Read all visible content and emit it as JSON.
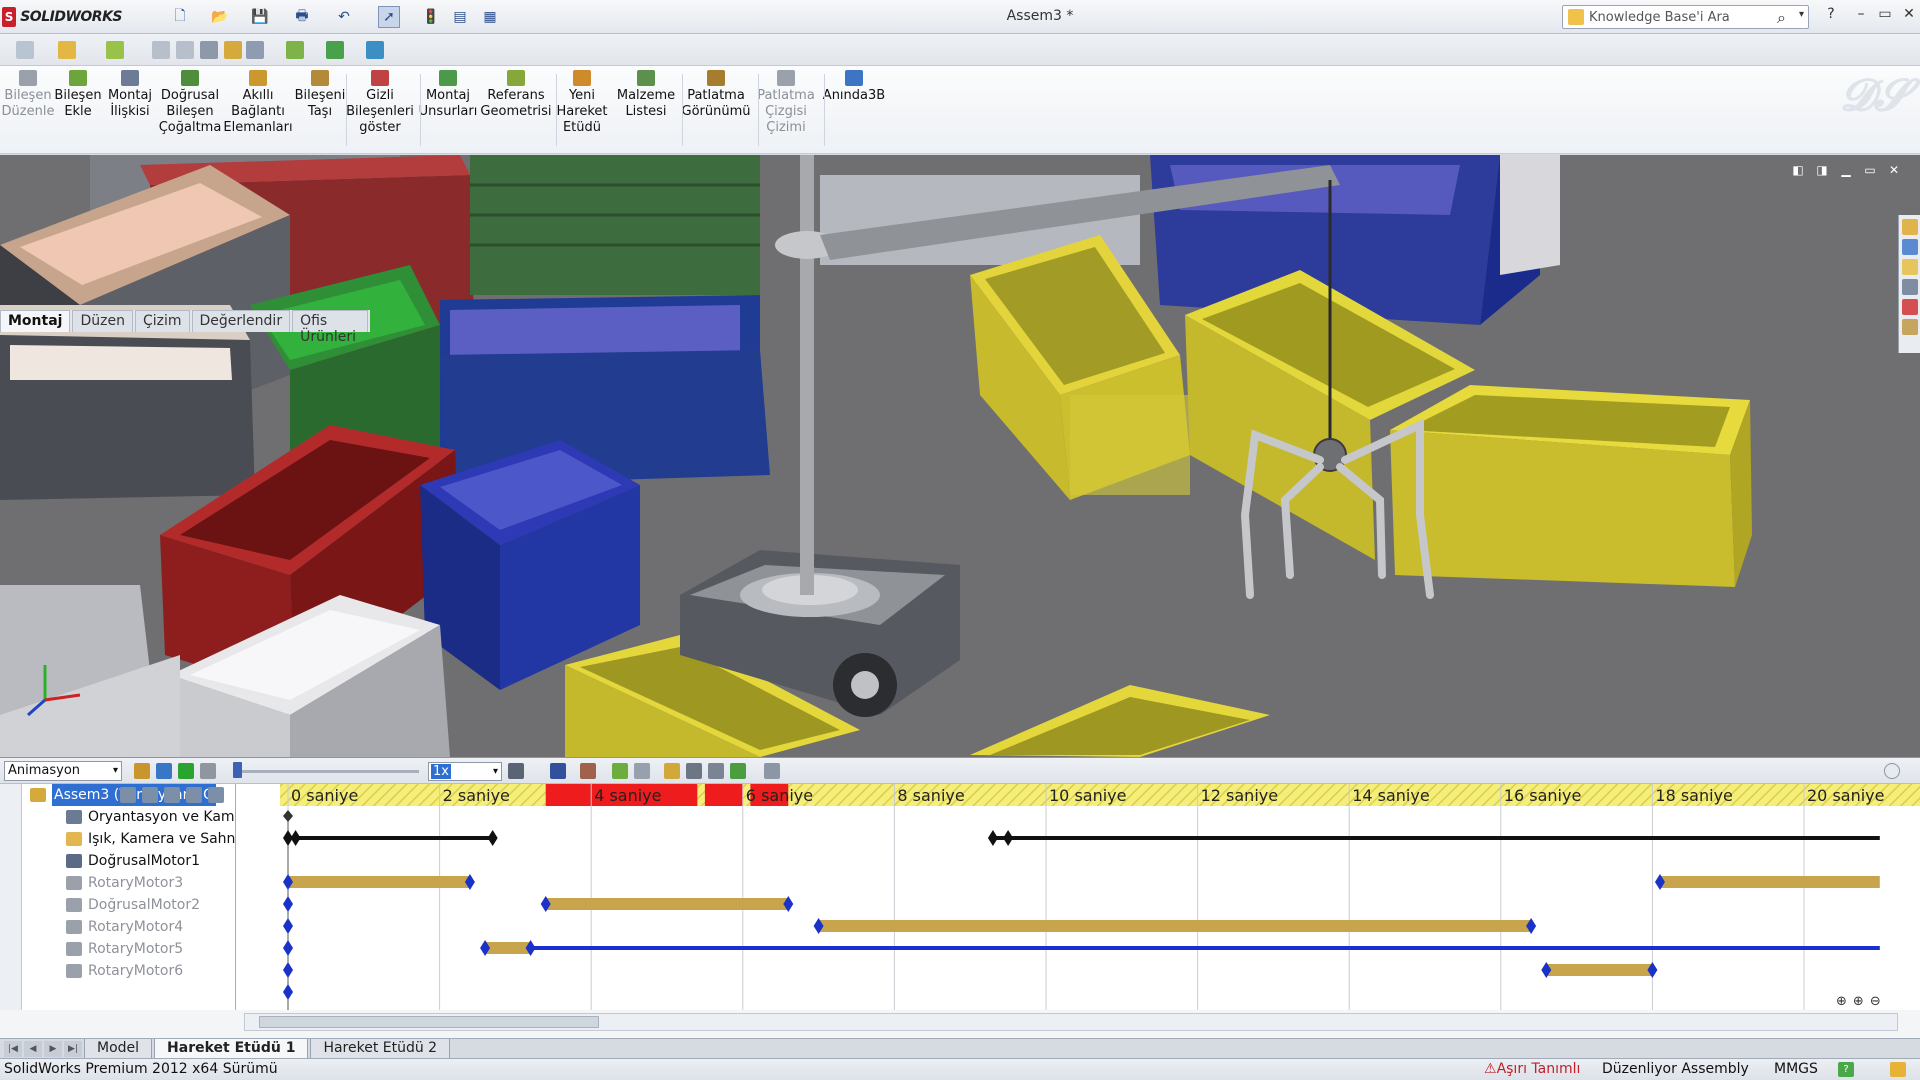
{
  "app": {
    "brand": "SOLIDWORKS",
    "doc_title": "Assem3 *"
  },
  "search": {
    "placeholder": "Knowledge Base'i Ara"
  },
  "window": {
    "help": "?",
    "minimize": "–",
    "restore": "▭",
    "close": "✕"
  },
  "commands": [
    {
      "id": "bileşen-düzenle",
      "label": "Bileşen\nDüzenle",
      "disabled": true,
      "color": "#9aa1ab"
    },
    {
      "id": "bileşen-ekle",
      "label": "Bileşen\nEkle",
      "disabled": false,
      "color": "#6da53c"
    },
    {
      "id": "montaj-ilişkisi",
      "label": "Montaj\nİlişkisi",
      "disabled": false,
      "color": "#6b7c94"
    },
    {
      "id": "doğrusal-çoğaltma",
      "label": "Doğrusal\nBileşen\nÇoğaltma",
      "disabled": false,
      "color": "#4e8e3a"
    },
    {
      "id": "akıllı-bağlantı",
      "label": "Akıllı\nBağlantı\nElemanları",
      "disabled": false,
      "color": "#c9982e"
    },
    {
      "id": "bileşeni-taşı",
      "label": "Bileşeni\nTaşı",
      "disabled": false,
      "color": "#b38a3a"
    },
    {
      "id": "gizli-bileşenler",
      "label": "Gizli\nBileşenleri\ngöster",
      "disabled": false,
      "color": "#c04343"
    },
    {
      "id": "montaj-unsurları",
      "label": "Montaj\nUnsurları",
      "disabled": false,
      "color": "#4c9a49"
    },
    {
      "id": "referans-geometri",
      "label": "Referans\nGeometrisi",
      "disabled": false,
      "color": "#86a83a"
    },
    {
      "id": "yeni-hareket-etüdü",
      "label": "Yeni\nHareket\nEtüdü",
      "disabled": false,
      "color": "#cf8a2b"
    },
    {
      "id": "malzeme-listesi",
      "label": "Malzeme\nListesi",
      "disabled": false,
      "color": "#5d8f4d"
    },
    {
      "id": "patlatma-görünümü",
      "label": "Patlatma\nGörünümü",
      "disabled": false,
      "color": "#a67c2e"
    },
    {
      "id": "patlatma-çizgisi",
      "label": "Patlatma\nÇizgisi\nÇizimi",
      "disabled": true,
      "color": "#9aa1ab"
    },
    {
      "id": "anında-3b",
      "label": "Anında3B",
      "disabled": false,
      "color": "#3e74c4"
    }
  ],
  "tabs": [
    "Montaj",
    "Düzen",
    "Çizim",
    "Değerlendir",
    "Ofis Ürünleri"
  ],
  "motion": {
    "study_type": "Animasyon",
    "speed": "1x",
    "tree": [
      {
        "label": "Assem3  (Varsayılan<G",
        "dim": false,
        "selected": true
      },
      {
        "label": "Oryantasyon ve Kamer",
        "dim": false
      },
      {
        "label": "Işık, Kamera ve Sahne",
        "dim": false
      },
      {
        "label": "DoğrusalMotor1",
        "dim": false
      },
      {
        "label": "RotaryMotor3",
        "dim": true
      },
      {
        "label": "DoğrusalMotor2",
        "dim": true
      },
      {
        "label": "RotaryMotor4",
        "dim": true
      },
      {
        "label": "RotaryMotor5",
        "dim": true
      },
      {
        "label": "RotaryMotor6",
        "dim": true
      }
    ],
    "ruler": [
      "0 saniye",
      "2 saniye",
      "4 saniye",
      "6 saniye",
      "8 saniye",
      "10 saniye",
      "12 saniye",
      "14 saniye",
      "16 saniye",
      "18 saniye",
      "20 saniye"
    ],
    "red_marks": [
      [
        3.4,
        5.4
      ],
      [
        5.5,
        6.0
      ],
      [
        6.1,
        6.6
      ]
    ],
    "tracks": [
      {
        "row": 1,
        "color": "#111111",
        "segments": [
          [
            0.1,
            2.7
          ],
          [
            9.3,
            21.0
          ]
        ],
        "keys": [
          0.0,
          0.1,
          2.7,
          9.3,
          9.5
        ]
      },
      {
        "row": 3,
        "color": "#c8a54c",
        "segments": [
          [
            0.0,
            2.4
          ],
          [
            18.1,
            21.0
          ]
        ],
        "keys": [
          0.0,
          2.4,
          18.1
        ]
      },
      {
        "row": 4,
        "color": "#c8a54c",
        "segments": [
          [
            3.4,
            6.6
          ]
        ],
        "keys": [
          0.0,
          3.4,
          6.6
        ]
      },
      {
        "row": 5,
        "color": "#c8a54c",
        "segments": [
          [
            7.0,
            16.4
          ]
        ],
        "keys": [
          0.0,
          7.0,
          16.4
        ]
      },
      {
        "row": 6,
        "color": "#c8a54c",
        "segments": [
          [
            2.6,
            3.2
          ]
        ],
        "keys": [
          0.0,
          2.6,
          3.2
        ]
      },
      {
        "row": 6,
        "color": "#1a2fd0",
        "segments": [
          [
            3.2,
            21.0
          ]
        ],
        "keys": []
      },
      {
        "row": 7,
        "color": "#c8a54c",
        "segments": [
          [
            16.6,
            18.0
          ]
        ],
        "keys": [
          0.0,
          16.6,
          18.0
        ]
      },
      {
        "row": 8,
        "color": "#c8a54c",
        "segments": [],
        "keys": [
          0.0
        ]
      }
    ]
  },
  "bottom_tabs": [
    "Model",
    "Hareket Etüdü 1",
    "Hareket Etüdü 2"
  ],
  "status": {
    "left": "SolidWorks Premium 2012 x64 Sürümü",
    "warning": "Aşırı Tanımlı",
    "mode": "Düzenliyor Assembly",
    "units": "MMGS",
    "help": "?"
  }
}
